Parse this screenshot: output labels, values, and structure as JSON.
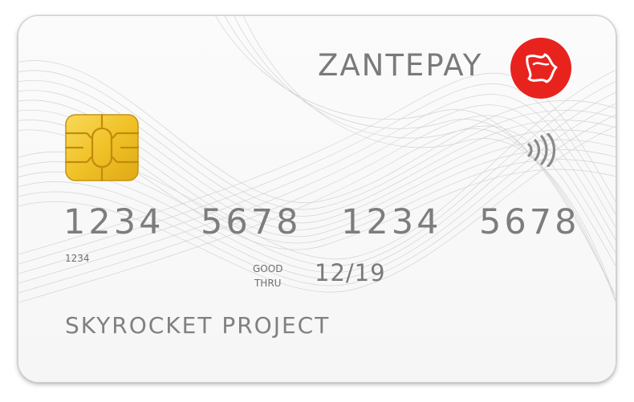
{
  "card": {
    "brand": "ZANTEPAY",
    "number_groups": [
      "1234",
      "5678",
      "1234",
      "5678"
    ],
    "small_number": "1234",
    "good_thru_line1": "GOOD",
    "good_thru_line2": "THRU",
    "expiry": "12/19",
    "holder_name": "SKYROCKET PROJECT"
  },
  "icons": {
    "logo": "zantepay-logo-icon",
    "chip": "emv-chip-icon",
    "contactless": "contactless-payment-icon"
  },
  "colors": {
    "card_background": "#f8f8f8",
    "text_gray": "#7a7a7a",
    "logo_red": "#e8231e",
    "chip_gold": "#f2c42e"
  }
}
